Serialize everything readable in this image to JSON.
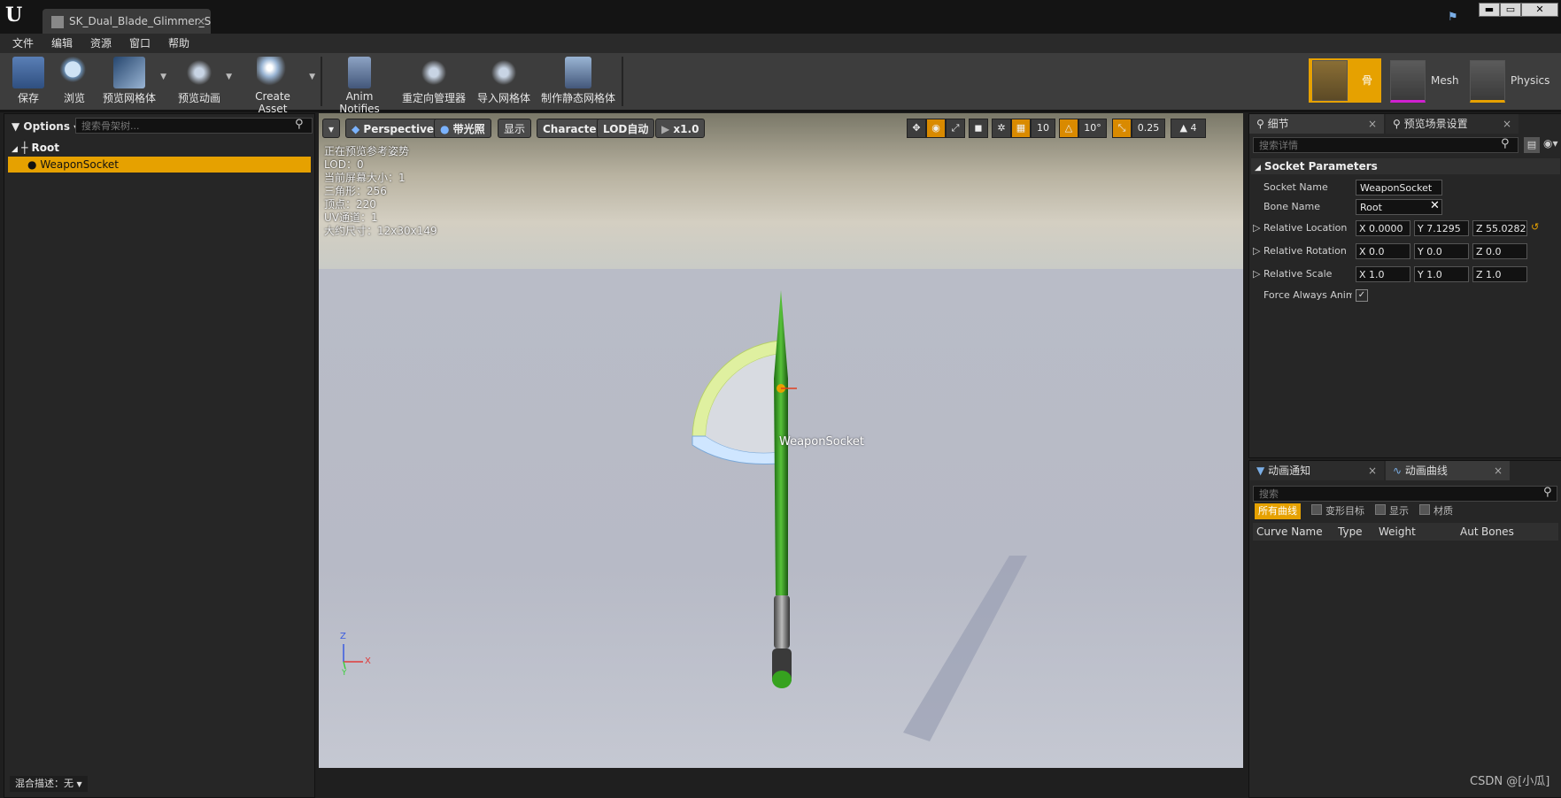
{
  "window": {
    "tab_title": "SK_Dual_Blade_Glimmer_S",
    "tab_close": "×",
    "minimize": "▬",
    "maximize": "▭",
    "close": "✕"
  },
  "menu": [
    "文件",
    "编辑",
    "资源",
    "窗口",
    "帮助"
  ],
  "toolbar": {
    "save": "保存",
    "browse": "浏览",
    "preview_mesh": "预览网格体",
    "preview_anim": "预览动画",
    "create_asset": "Create Asset",
    "anim_notifies": "Anim Notifies",
    "retarget_manager": "重定向管理器",
    "import_mesh": "导入网格体",
    "make_static_mesh": "制作静态网格体"
  },
  "modes": {
    "skeleton": "骨架",
    "mesh": "Mesh",
    "physics": "Physics"
  },
  "skeleton_tree": {
    "options": "Options",
    "search_placeholder": "搜索骨架树...",
    "root": "Root",
    "socket": "WeaponSocket",
    "blend_desc": "混合描述：无"
  },
  "viewport": {
    "perspective": "Perspective",
    "lit": "带光照",
    "show": "显示",
    "character": "Character",
    "lod": "LOD自动",
    "speed": "x1.0",
    "grid_size": "10",
    "rot_snap": "10°",
    "scale_snap": "0.25",
    "cam_speed": "4",
    "stats": [
      "正在预览参考姿势",
      "LOD：0",
      "当前屏幕大小：1",
      "三角形：256",
      "顶点：220",
      "UV通道：1",
      "大约尺寸：12x30x149"
    ],
    "socket_label": "WeaponSocket",
    "axis_z": "Z",
    "axis_x": "X",
    "axis_y": "Y"
  },
  "details": {
    "tab_details": "细节",
    "tab_preview": "预览场景设置",
    "search_placeholder": "搜索详情",
    "section": "Socket Parameters",
    "socket_name_label": "Socket Name",
    "socket_name_value": "WeaponSocket",
    "bone_name_label": "Bone Name",
    "bone_name_value": "Root",
    "rel_location_label": "Relative Location",
    "loc_x": "X  0.0000",
    "loc_y": "Y  7.1295",
    "loc_z": "Z  55.0282",
    "rel_rotation_label": "Relative Rotation",
    "rot_x": "X  0.0",
    "rot_y": "Y  0.0",
    "rot_z": "Z  0.0",
    "rel_scale_label": "Relative Scale",
    "scale_x": "X  1.0",
    "scale_y": "Y  1.0",
    "scale_z": "Z  1.0",
    "force_label": "Force Always Animated"
  },
  "curves": {
    "tab_notifies": "动画通知",
    "tab_curves": "动画曲线",
    "search_placeholder": "搜索",
    "all_curves": "所有曲线",
    "morph": "变形目标",
    "show": "显示",
    "material": "材质",
    "col_name": "Curve Name",
    "col_type": "Type",
    "col_weight": "Weight",
    "col_auto": "Aut",
    "col_bones": "Bones"
  },
  "watermark": "CSDN @[小瓜]",
  "colors": {
    "accent": "#e6a100",
    "blade_green": "#2f9a1a",
    "arc_yellow": "#dff0a0"
  }
}
